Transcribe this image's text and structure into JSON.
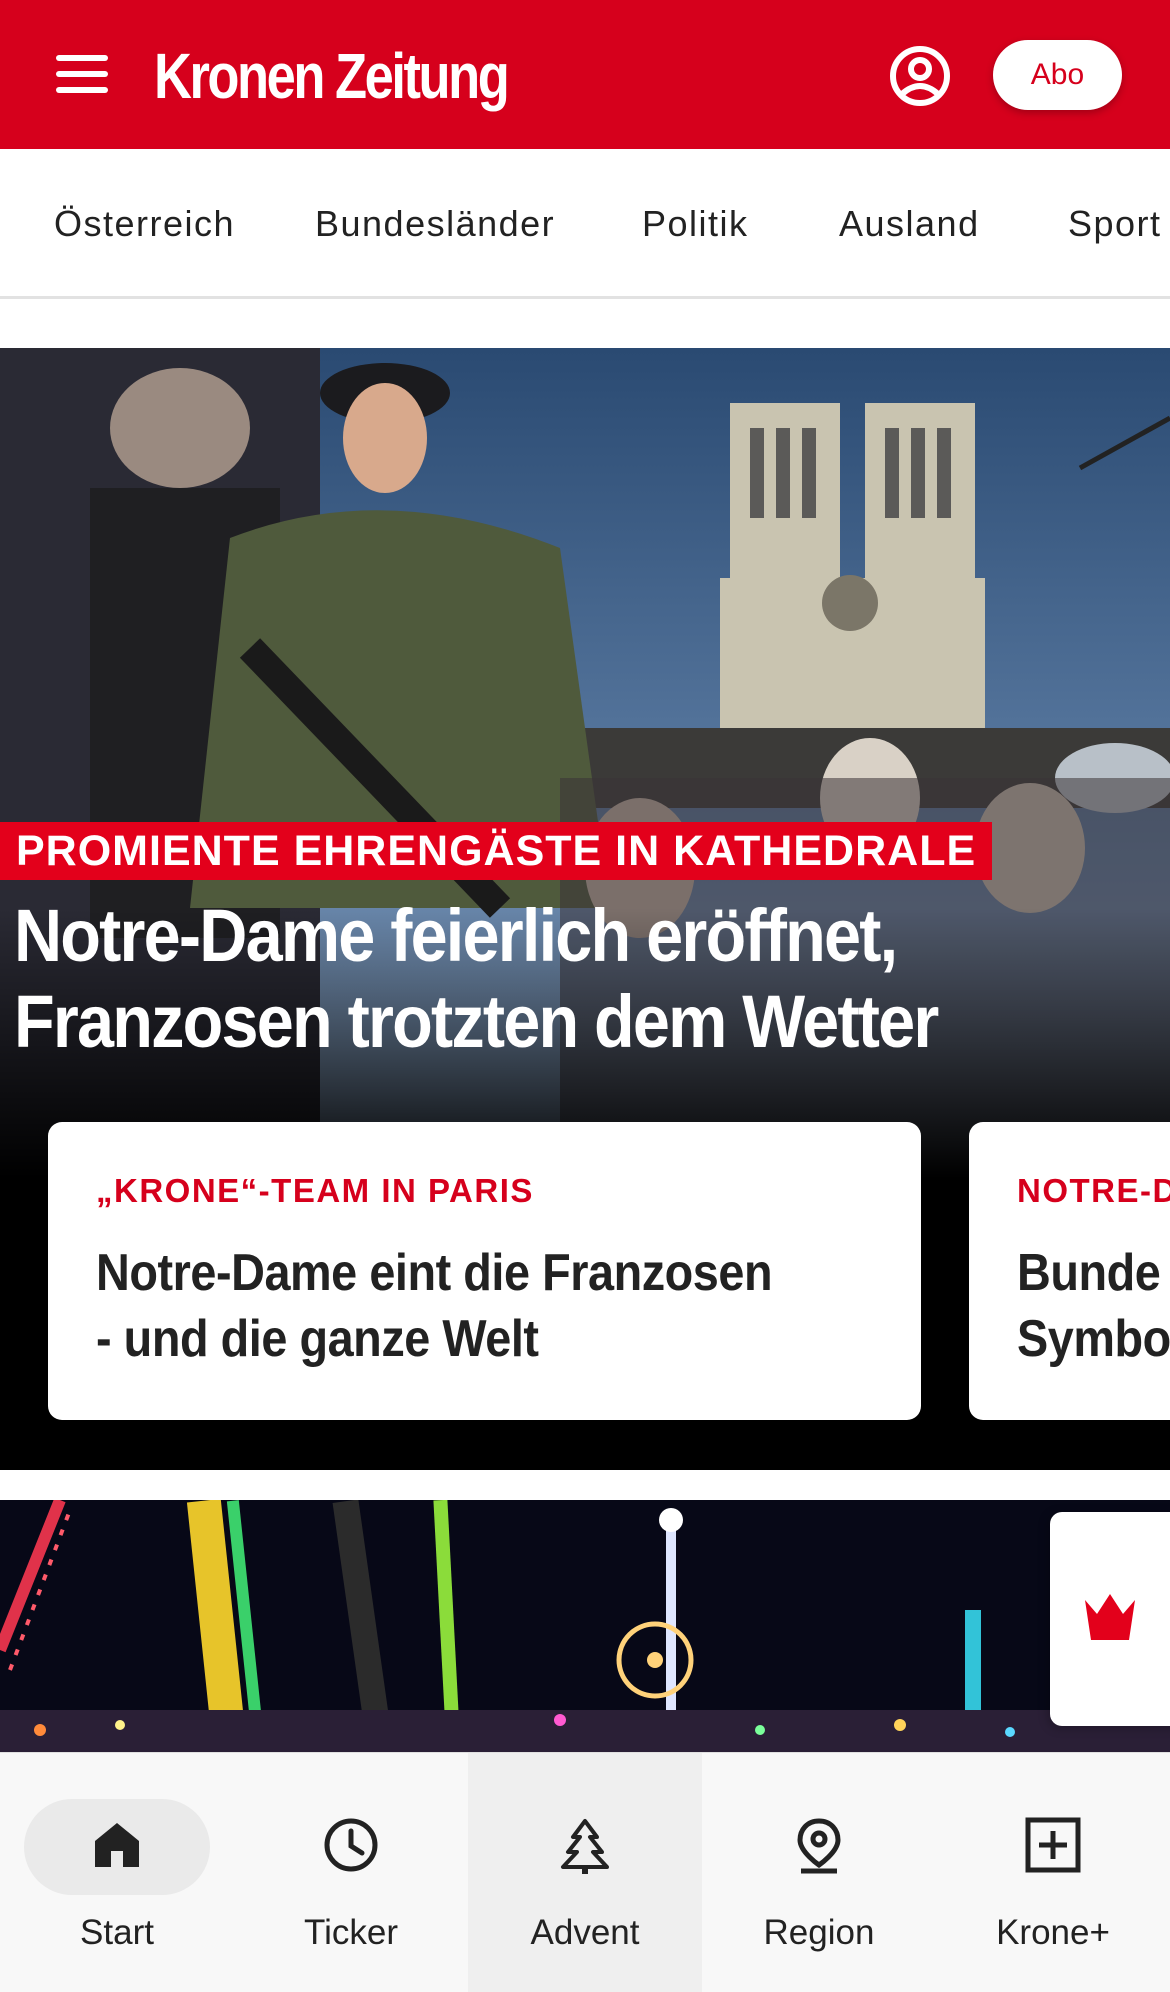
{
  "header": {
    "logo_text": "Kronen Zeitung",
    "abo_label": "Abo",
    "brand_color": "#d6001c",
    "icons": {
      "menu": "hamburger-menu-icon",
      "profile": "user-account-icon"
    }
  },
  "categories": [
    {
      "label": "Österreich"
    },
    {
      "label": "Bundesländer"
    },
    {
      "label": "Politik"
    },
    {
      "label": "Ausland"
    },
    {
      "label": "Sport"
    }
  ],
  "hero": {
    "kicker": "PROMIENTE EHRENGÄSTE IN KATHEDRALE",
    "title_line1": "Notre-Dame feierlich eröffnet,",
    "title_line2": "Franzosen trotzten dem Wetter",
    "cards": [
      {
        "kicker": "„KRONE“-TEAM IN PARIS",
        "title_line1": "Notre-Dame eint die Franzosen",
        "title_line2": "- und die ganze Welt"
      },
      {
        "kicker": "NOTRE-D",
        "title_line1": "Bunde",
        "title_line2": "Symbo"
      }
    ]
  },
  "side_widget": {
    "icon": "krone-crown-icon"
  },
  "bottom_nav": {
    "active": "Start",
    "items": [
      {
        "label": "Start",
        "icon": "home-icon"
      },
      {
        "label": "Ticker",
        "icon": "clock-icon"
      },
      {
        "label": "Advent",
        "icon": "christmas-tree-icon"
      },
      {
        "label": "Region",
        "icon": "location-pin-icon"
      },
      {
        "label": "Krone+",
        "icon": "plus-box-icon"
      }
    ]
  }
}
